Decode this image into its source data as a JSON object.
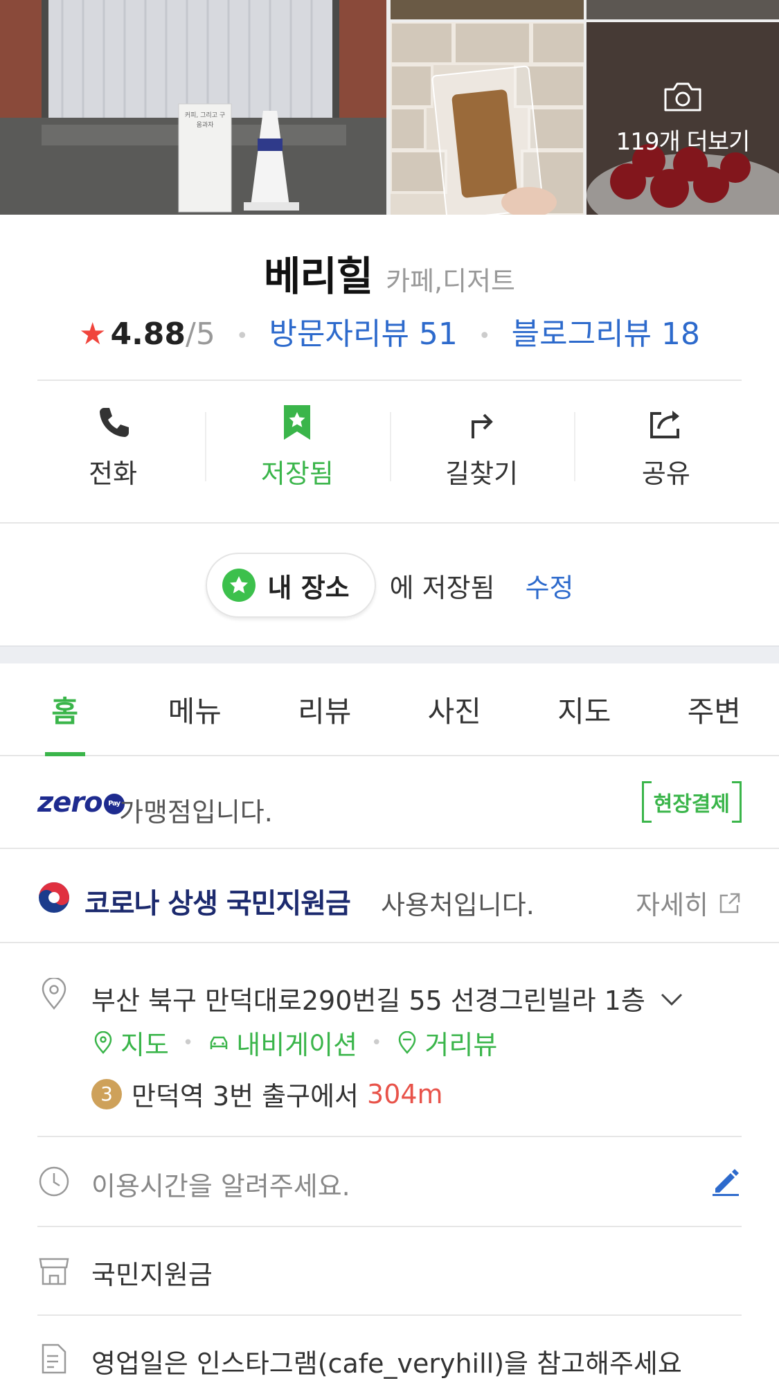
{
  "gallery": {
    "more_label": "119개 더보기",
    "sign_text": "커피, 그리고 구움과자"
  },
  "place": {
    "name": "베리힐",
    "category": "카페,디저트",
    "rating": "4.88",
    "rating_max": "/5",
    "visitor_reviews": "방문자리뷰 51",
    "blog_reviews": "블로그리뷰 18"
  },
  "actions": [
    {
      "label": "전화",
      "icon": "phone-icon"
    },
    {
      "label": "저장됨",
      "icon": "bookmark-star-icon"
    },
    {
      "label": "길찾기",
      "icon": "directions-icon"
    },
    {
      "label": "공유",
      "icon": "share-icon"
    }
  ],
  "saved": {
    "folder": "내 장소",
    "text": "에 저장됨",
    "edit": "수정"
  },
  "tabs": [
    "홈",
    "메뉴",
    "리뷰",
    "사진",
    "지도",
    "주변"
  ],
  "active_tab": "홈",
  "zero_pay": {
    "logo": "zero",
    "logo_badge": "Pay",
    "text": "가맹점입니다.",
    "badge": "현장결제"
  },
  "support_fund": {
    "title": "코로나 상생 국민지원금",
    "text": "사용처입니다.",
    "detail": "자세히"
  },
  "address": {
    "text": "부산 북구 만덕대로290번길 55 선경그린빌라 1층",
    "links": [
      "지도",
      "내비게이션",
      "거리뷰"
    ],
    "subway_line": "3",
    "subway_text": "만덕역 3번 출구에서",
    "distance": "304m"
  },
  "hours": {
    "placeholder": "이용시간을 알려주세요."
  },
  "store_type": "국민지원금",
  "notice": "영업일은 인스타그램(cafe_veryhill)을 참고해주세요",
  "colors": {
    "green": "#3ab54a",
    "blue_link": "#2d6acc",
    "star_red": "#f0443c",
    "distance_red": "#e8534a",
    "zero_navy": "#1e2b8f"
  }
}
